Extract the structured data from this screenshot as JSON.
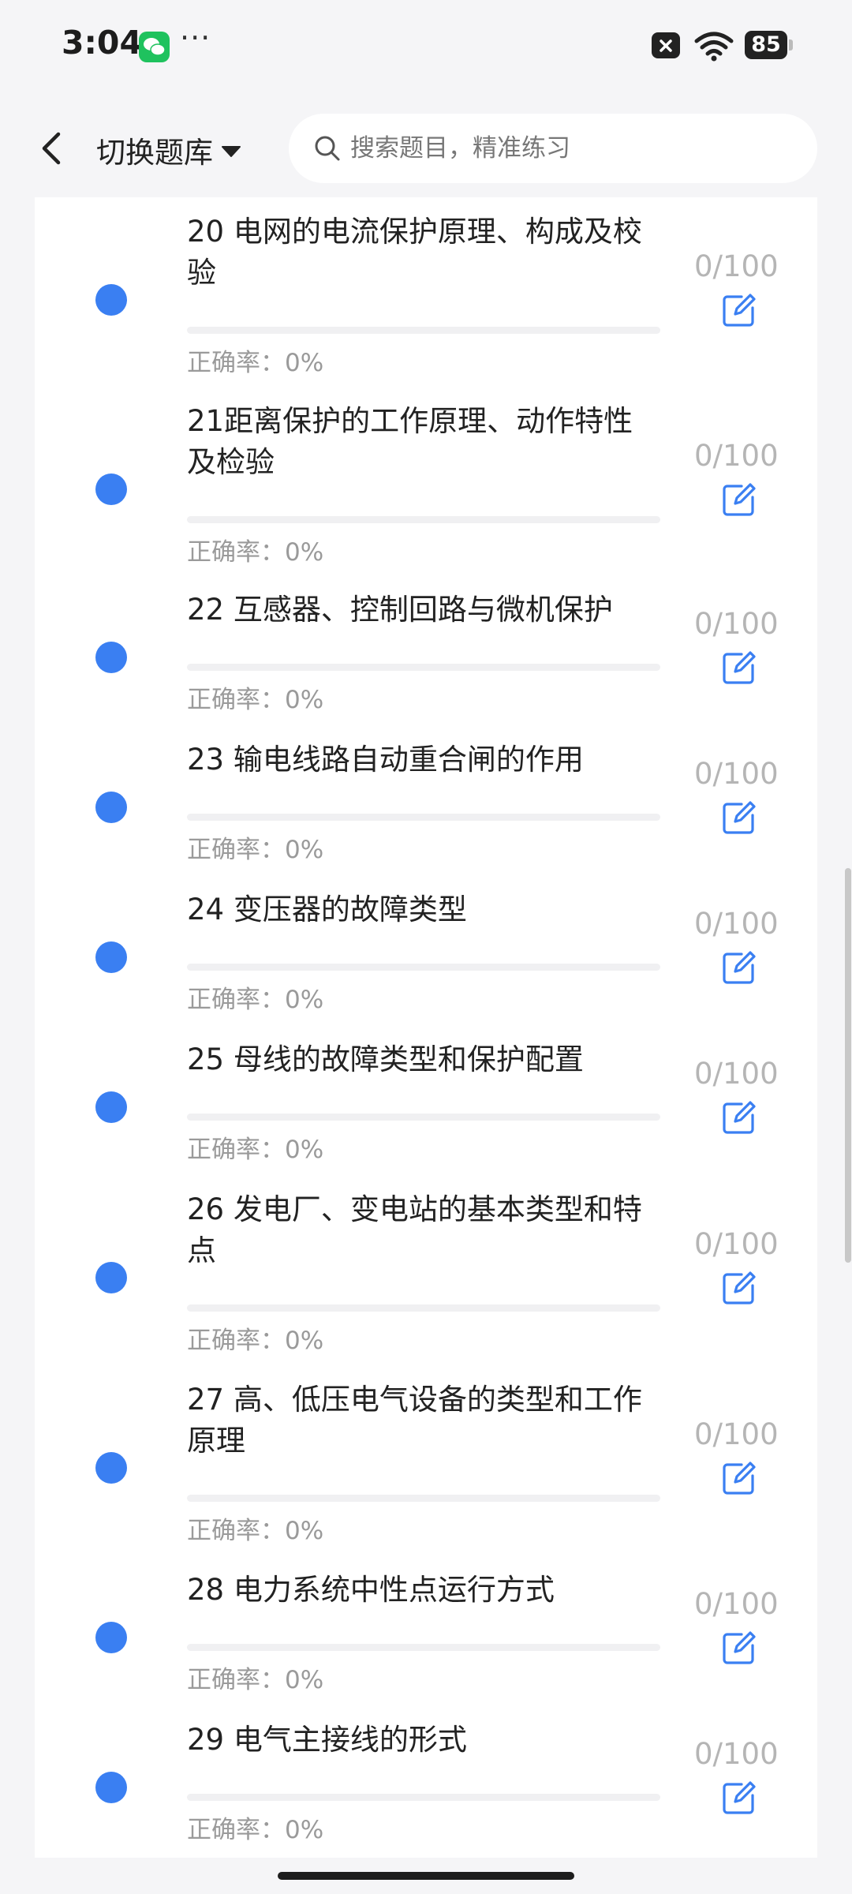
{
  "status_bar": {
    "time": "3:04",
    "more": "···",
    "battery": "85"
  },
  "header": {
    "bank_label": "切换题库",
    "search_placeholder": "搜索题目，精准练习"
  },
  "items": [
    {
      "title": "20 电网的电流保护原理、构成及校验",
      "accuracy_label": "正确率：",
      "accuracy": "0%",
      "count": "0/100",
      "progress": 0
    },
    {
      "title": "21距离保护的工作原理、动作特性及检验",
      "accuracy_label": "正确率：",
      "accuracy": "0%",
      "count": "0/100",
      "progress": 0
    },
    {
      "title": "22 互感器、控制回路与微机保护",
      "accuracy_label": "正确率：",
      "accuracy": "0%",
      "count": "0/100",
      "progress": 0
    },
    {
      "title": "23 输电线路自动重合闸的作用",
      "accuracy_label": "正确率：",
      "accuracy": "0%",
      "count": "0/100",
      "progress": 0
    },
    {
      "title": "24 变压器的故障类型",
      "accuracy_label": "正确率：",
      "accuracy": "0%",
      "count": "0/100",
      "progress": 0
    },
    {
      "title": "25 母线的故障类型和保护配置",
      "accuracy_label": "正确率：",
      "accuracy": "0%",
      "count": "0/100",
      "progress": 0
    },
    {
      "title": "26 发电厂、变电站的基本类型和特点",
      "accuracy_label": "正确率：",
      "accuracy": "0%",
      "count": "0/100",
      "progress": 0
    },
    {
      "title": "27 高、低压电气设备的类型和工作原理",
      "accuracy_label": "正确率：",
      "accuracy": "0%",
      "count": "0/100",
      "progress": 0
    },
    {
      "title": "28 电力系统中性点运行方式",
      "accuracy_label": "正确率：",
      "accuracy": "0%",
      "count": "0/100",
      "progress": 0
    },
    {
      "title": "29 电气主接线的形式",
      "accuracy_label": "正确率：",
      "accuracy": "0%",
      "count": "0/100",
      "progress": 0
    }
  ],
  "icons": {
    "back": "chevron-left-icon",
    "caret": "caret-down-icon",
    "search": "search-icon",
    "edit": "edit-icon",
    "status_dot": "dot-icon"
  },
  "colors": {
    "accent": "#3a7ff2",
    "muted": "#9a9a9a",
    "count": "#b5b5b5"
  }
}
